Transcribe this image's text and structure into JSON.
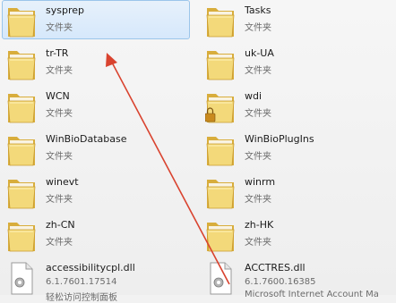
{
  "items": [
    {
      "name": "sysprep",
      "type": "文件夹",
      "icon": "folder-icon",
      "selected": true
    },
    {
      "name": "Tasks",
      "type": "文件夹",
      "icon": "folder-icon",
      "selected": false
    },
    {
      "name": "tr-TR",
      "type": "文件夹",
      "icon": "folder-icon",
      "selected": false
    },
    {
      "name": "uk-UA",
      "type": "文件夹",
      "icon": "folder-icon",
      "selected": false
    },
    {
      "name": "WCN",
      "type": "文件夹",
      "icon": "folder-icon",
      "selected": false
    },
    {
      "name": "wdi",
      "type": "文件夹",
      "icon": "locked-folder-icon",
      "selected": false
    },
    {
      "name": "WinBioDatabase",
      "type": "文件夹",
      "icon": "folder-icon",
      "selected": false
    },
    {
      "name": "WinBioPlugIns",
      "type": "文件夹",
      "icon": "folder-icon",
      "selected": false
    },
    {
      "name": "winevt",
      "type": "文件夹",
      "icon": "folder-icon",
      "selected": false
    },
    {
      "name": "winrm",
      "type": "文件夹",
      "icon": "folder-icon",
      "selected": false
    },
    {
      "name": "zh-CN",
      "type": "文件夹",
      "icon": "folder-icon",
      "selected": false
    },
    {
      "name": "zh-HK",
      "type": "文件夹",
      "icon": "folder-icon",
      "selected": false
    },
    {
      "name": "accessibilitycpl.dll",
      "type": "6.1.7601.17514",
      "desc": "轻松访问控制面板",
      "icon": "dll-file-icon",
      "selected": false
    },
    {
      "name": "ACCTRES.dll",
      "type": "6.1.7600.16385",
      "desc": "Microsoft Internet Account Ma",
      "icon": "dll-file-icon",
      "selected": false
    }
  ],
  "colors": {
    "folder_front": "#f3d97a",
    "folder_back": "#e2b84a",
    "selection": "#d6e8fb",
    "arrow": "#d9432f"
  }
}
